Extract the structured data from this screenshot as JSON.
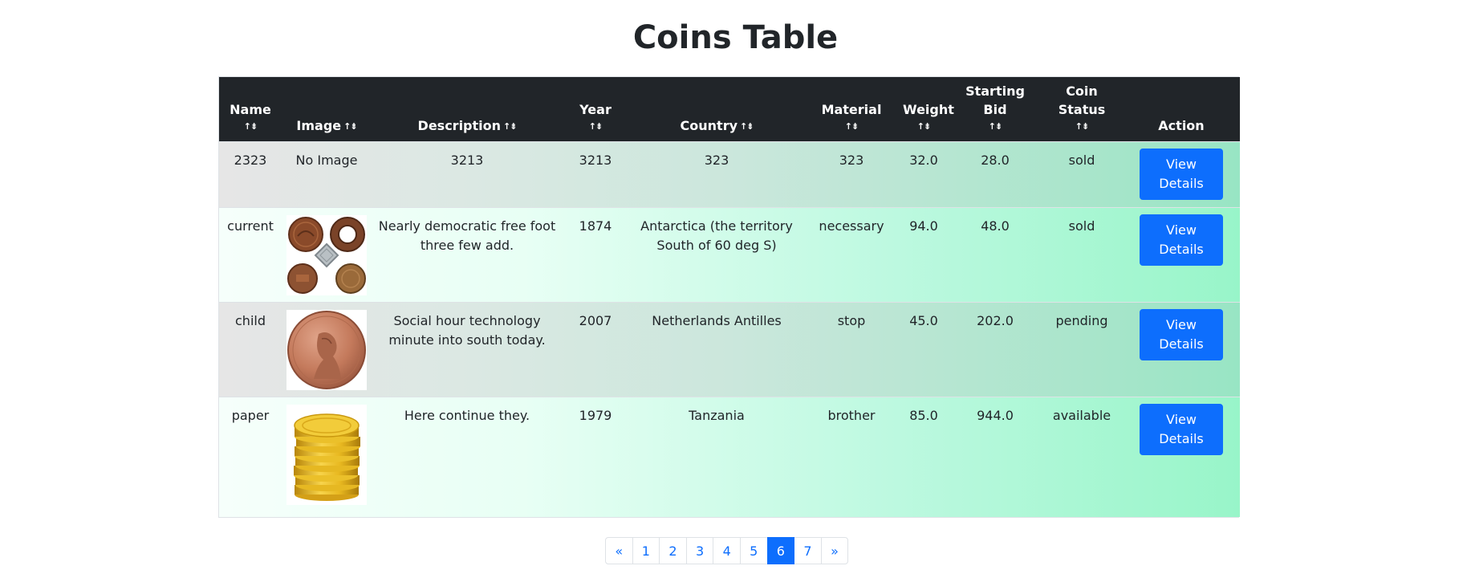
{
  "page": {
    "title": "Coins Table"
  },
  "table": {
    "headers": {
      "name": "Name",
      "image": "Image",
      "description": "Description",
      "year": "Year",
      "country": "Country",
      "material": "Material",
      "weight": "Weight",
      "starting_bid": "Starting Bid",
      "coin_status": "Coin Status",
      "action": "Action"
    },
    "sort_icon": "sort-icon",
    "rows": [
      {
        "name": "2323",
        "image_text": "No Image",
        "image_icon": "",
        "description": "3213",
        "year": "3213",
        "country": "323",
        "material": "323",
        "weight": "32.0",
        "starting_bid": "28.0",
        "coin_status": "sold",
        "action_label": "View Details"
      },
      {
        "name": "current",
        "image_text": "",
        "image_icon": "assorted-coins-image",
        "description": "Nearly democratic free foot three few add.",
        "year": "1874",
        "country": "Antarctica (the territory South of 60 deg S)",
        "material": "necessary",
        "weight": "94.0",
        "starting_bid": "48.0",
        "coin_status": "sold",
        "action_label": "View Details"
      },
      {
        "name": "child",
        "image_text": "",
        "image_icon": "penny-coin-image",
        "description": "Social hour technology minute into south today.",
        "year": "2007",
        "country": "Netherlands Antilles",
        "material": "stop",
        "weight": "45.0",
        "starting_bid": "202.0",
        "coin_status": "pending",
        "action_label": "View Details"
      },
      {
        "name": "paper",
        "image_text": "",
        "image_icon": "gold-coin-stack-image",
        "description": "Here continue they.",
        "year": "1979",
        "country": "Tanzania",
        "material": "brother",
        "weight": "85.0",
        "starting_bid": "944.0",
        "coin_status": "available",
        "action_label": "View Details"
      }
    ]
  },
  "pagination": {
    "prev": "«",
    "pages": [
      "1",
      "2",
      "3",
      "4",
      "5",
      "6",
      "7"
    ],
    "active_page": "6",
    "next": "»"
  },
  "colors": {
    "header_bg": "#212529",
    "button_blue": "#0d6efd",
    "row_gradient_end": "#98f5c9"
  }
}
